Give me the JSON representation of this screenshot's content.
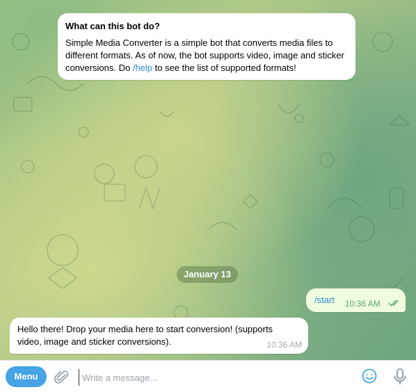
{
  "bot_info": {
    "title": "What can this bot do?",
    "text_before_link": "Simple Media Converter is a simple bot that converts media files to different formats. As of now, the bot supports video, image and sticker conversions. Do ",
    "link": "/help",
    "text_after_link": " to see the list of supported formats!"
  },
  "date_separator": "January 13",
  "messages": [
    {
      "direction": "outgoing",
      "text": "/start",
      "time": "10:36 AM",
      "status": "read"
    },
    {
      "direction": "incoming",
      "text": "Hello there! Drop your media here to start conversion! (supports video, image and sticker conversions).",
      "time": "10:36 AM"
    }
  ],
  "composer": {
    "menu_label": "Menu",
    "placeholder": "Write a message...",
    "value": ""
  },
  "colors": {
    "accent": "#45a3e6",
    "link": "#2a8bd3",
    "outgoing_bubble": "#effdde",
    "read_checks": "#5fa761"
  },
  "icons": [
    "paperclip-icon",
    "emoji-icon",
    "microphone-icon",
    "double-check-icon"
  ]
}
